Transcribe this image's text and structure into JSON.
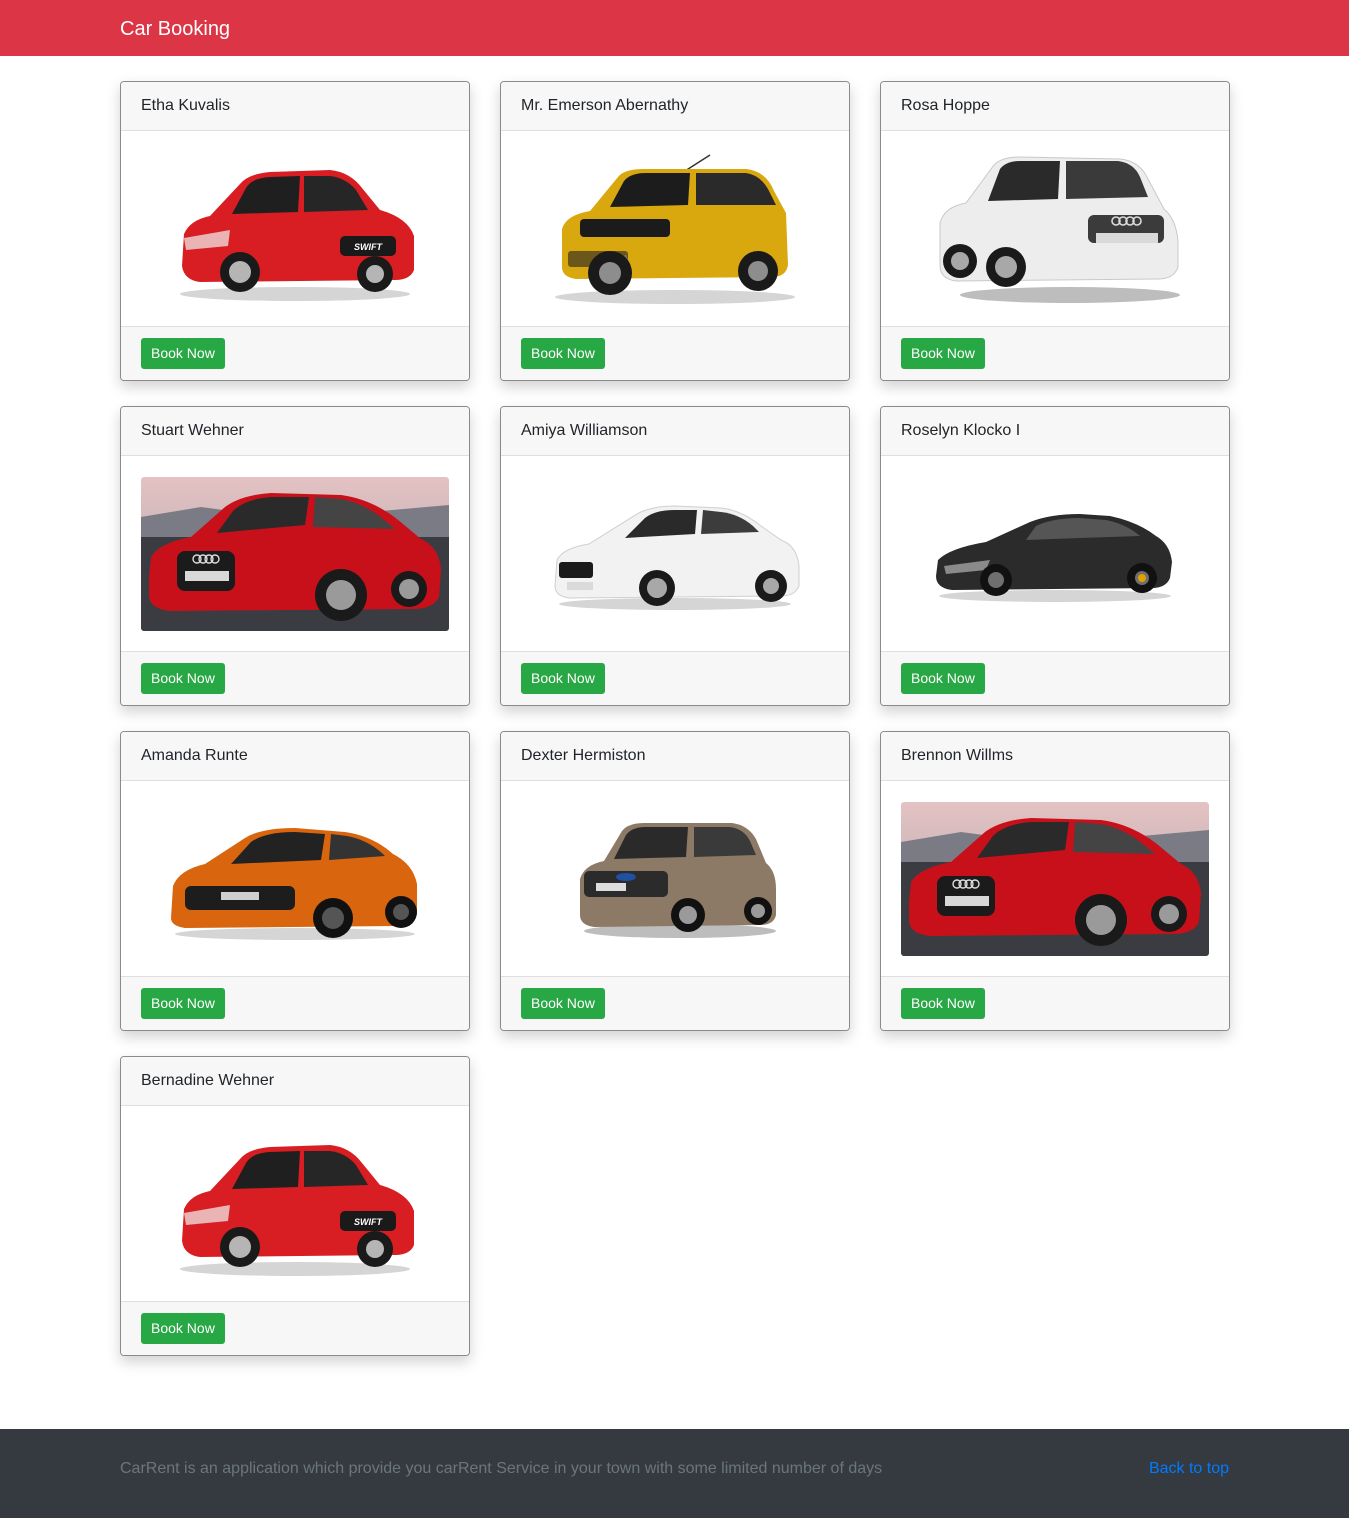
{
  "navbar": {
    "brand": "Car Booking"
  },
  "cars": [
    {
      "owner": "Etha Kuvalis",
      "book_label": "Book Now",
      "image": "red-hatchback-car",
      "color": "#d81e22"
    },
    {
      "owner": "Mr. Emerson Abernathy",
      "book_label": "Book Now",
      "image": "yellow-compact-suv",
      "color": "#d9a80f"
    },
    {
      "owner": "Rosa Hoppe",
      "book_label": "Book Now",
      "image": "white-suv",
      "color": "#e8e8e8"
    },
    {
      "owner": "Stuart Wehner",
      "book_label": "Book Now",
      "image": "red-sportback-photo",
      "color": "#c8101b"
    },
    {
      "owner": "Amiya Williamson",
      "book_label": "Book Now",
      "image": "white-coupe",
      "color": "#f0f0f0"
    },
    {
      "owner": "Roselyn Klocko I",
      "book_label": "Book Now",
      "image": "black-supercar",
      "color": "#2b2b2b"
    },
    {
      "owner": "Amanda Runte",
      "book_label": "Book Now",
      "image": "orange-sports-car",
      "color": "#d9650e"
    },
    {
      "owner": "Dexter Hermiston",
      "book_label": "Book Now",
      "image": "bronze-suv",
      "color": "#8c7a66"
    },
    {
      "owner": "Brennon Willms",
      "book_label": "Book Now",
      "image": "red-sportback-photo",
      "color": "#c8101b"
    },
    {
      "owner": "Bernadine Wehner",
      "book_label": "Book Now",
      "image": "red-hatchback-car",
      "color": "#d81e22"
    }
  ],
  "footer": {
    "text": "CarRent is an application which provide you carRent Service in your town with some limited number of days",
    "back_to_top": "Back to top"
  },
  "colors": {
    "navbar": "#dc3545",
    "button": "#28a745",
    "footer": "#343a40",
    "link": "#007bff"
  }
}
